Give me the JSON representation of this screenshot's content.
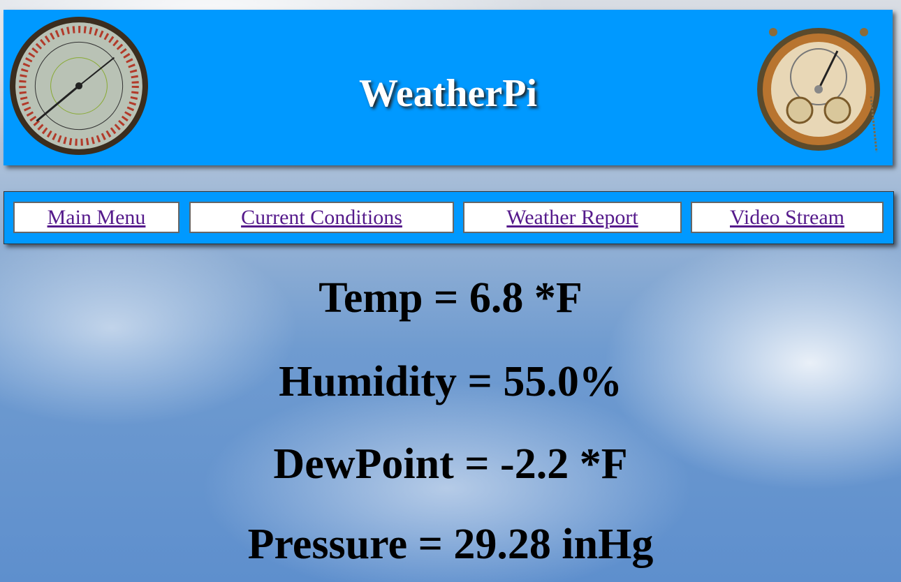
{
  "header": {
    "title": "WeatherPi",
    "left_icon": "thermometer-gauge-icon",
    "right_icon": "barometer-gauge-icon"
  },
  "nav": {
    "items": [
      {
        "label": "Main Menu"
      },
      {
        "label": "Current Conditions"
      },
      {
        "label": "Weather Report"
      },
      {
        "label": "Video Stream"
      }
    ]
  },
  "readings": {
    "temp": "Temp = 6.8 *F",
    "humidity": "Humidity = 55.0%",
    "dewpoint": "DewPoint = -2.2 *F",
    "pressure": "Pressure = 29.28 inHg"
  },
  "colors": {
    "header_bg": "#0099ff",
    "link": "#551a8b"
  }
}
